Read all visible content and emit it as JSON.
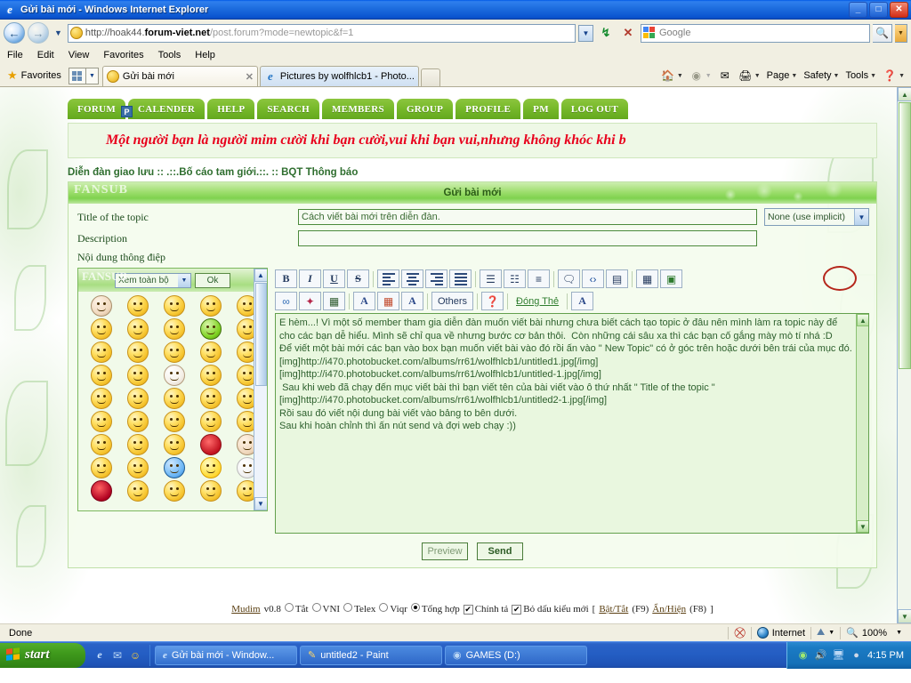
{
  "window": {
    "title": "Gửi bài mới - Windows Internet Explorer",
    "minimize": "_",
    "maximize": "□",
    "close": "✕"
  },
  "navigation": {
    "back": "←",
    "forward": "→",
    "history_caret": "▼",
    "url_prefix": "http://hoak44.",
    "url_domain": "forum-viet.net",
    "url_suffix": "/post.forum?mode=newtopic&f=1",
    "refresh": "↯",
    "stop": "✕",
    "address_dropdown": "▼"
  },
  "search": {
    "placeholder": "Google",
    "go_icon": "search-icon",
    "dropdown": "▼"
  },
  "menu": {
    "items": [
      "File",
      "Edit",
      "View",
      "Favorites",
      "Tools",
      "Help"
    ]
  },
  "tabstrip": {
    "favorites_label": "Favorites",
    "tabs": [
      {
        "label": "Gửi bài mới",
        "active": true,
        "close": "✕"
      },
      {
        "label": "Pictures by wolfhlcb1 - Photo...",
        "active": false,
        "close": ""
      }
    ]
  },
  "commandbar": {
    "items": [
      {
        "name": "home",
        "label": "",
        "caret": "▼"
      },
      {
        "name": "feeds",
        "label": "",
        "caret": "▼"
      },
      {
        "name": "mail",
        "label": "",
        "caret": ""
      },
      {
        "name": "print",
        "label": "",
        "caret": "▼"
      },
      {
        "name": "page",
        "label": "Page",
        "caret": "▼"
      },
      {
        "name": "safety",
        "label": "Safety",
        "caret": "▼"
      },
      {
        "name": "tools",
        "label": "Tools",
        "caret": "▼"
      },
      {
        "name": "help",
        "label": "",
        "caret": "▼"
      }
    ]
  },
  "forum": {
    "nav_tabs": [
      "FORUM",
      "CALENDER",
      "HELP",
      "SEARCH",
      "MEMBERS",
      "GROUP",
      "PROFILE",
      "PM",
      "LOG OUT"
    ],
    "p_badge": "P",
    "banner_text": "Một người bạn là người mim cười khi bạn cười,vui khi bạn vui,nhưng không khóc khi b",
    "breadcrumb": "Diễn đàn giao lưu  :: .::.Bố cáo tam giới.::. :: BQT Thông báo",
    "panel_title": "Gửi bài mới",
    "panel_watermark": "FANSUB",
    "fields": {
      "title_label": "Title of the topic",
      "title_value": "Cách viết bài mới trên diễn đàn.",
      "description_label": "Description",
      "description_value": "",
      "icon_select_value": "None (use implicit)",
      "message_label": "Nội dung thông điệp"
    },
    "smiley_panel": {
      "view_select": "Xem toàn bộ",
      "ok_button": "Ok",
      "scroll_up": "▲",
      "scroll_down": "▼"
    },
    "editor_toolbar": {
      "row1": [
        {
          "name": "bold-button",
          "glyph": "B",
          "style": "bold"
        },
        {
          "name": "italic-button",
          "glyph": "I",
          "style": "italic"
        },
        {
          "name": "underline-button",
          "glyph": "U",
          "style": "underline"
        },
        {
          "name": "strikethrough-button",
          "glyph": "S",
          "style": "strike"
        },
        {
          "name": "align-left-button",
          "glyph": "align-left-icon",
          "style": "align"
        },
        {
          "name": "align-center-button",
          "glyph": "align-center-icon",
          "style": "align"
        },
        {
          "name": "align-right-button",
          "glyph": "align-right-icon",
          "style": "align"
        },
        {
          "name": "align-justify-button",
          "glyph": "align-justify-icon",
          "style": "align"
        },
        {
          "name": "bullet-list-button",
          "glyph": "☰",
          "style": "icon"
        },
        {
          "name": "numbered-list-button",
          "glyph": "☷",
          "style": "icon"
        },
        {
          "name": "indent-button",
          "glyph": "≡",
          "style": "icon"
        },
        {
          "name": "quote-button",
          "glyph": "❝",
          "style": "icon"
        },
        {
          "name": "code-button",
          "glyph": "‹›",
          "style": "icon"
        },
        {
          "name": "table-button",
          "glyph": "▤",
          "style": "icon"
        },
        {
          "name": "insert-image-button",
          "glyph": "🖼",
          "style": "icon"
        },
        {
          "name": "upload-image-button",
          "glyph": "▣",
          "style": "icon"
        }
      ],
      "row2": [
        {
          "name": "link-button",
          "glyph": "∞",
          "style": "icon"
        },
        {
          "name": "flash-button",
          "glyph": "⚡",
          "style": "icon"
        },
        {
          "name": "video-button",
          "glyph": "▦",
          "style": "icon"
        },
        {
          "name": "font-color-button",
          "glyph": "A",
          "style": "icon"
        },
        {
          "name": "color-palette-button",
          "glyph": "⣿",
          "style": "icon"
        },
        {
          "name": "font-family-button",
          "glyph": "A",
          "style": "icon"
        },
        {
          "name": "others-button",
          "glyph": "Others",
          "style": "text"
        },
        {
          "name": "help-button",
          "glyph": "?",
          "style": "icon"
        },
        {
          "name": "close-tag-button",
          "glyph": "Đóng Thẻ",
          "style": "link"
        },
        {
          "name": "font-size-button",
          "glyph": "A",
          "style": "icon"
        }
      ]
    },
    "message_body": "E hèm...! Vì một số member tham gia diễn đàn muốn viết bài nhưng chưa biết cách tạo topic ở đâu nên mình làm ra topic này để cho các bạn dễ hiểu. Mình sẽ chỉ qua về nhưng bước cơ bản thôi.  Còn những cái sâu xa thì các bạn cố gắng mày mò tí nhá :D\nĐể viết một bài mới các bạn vào box bạn muốn viết bài vào đó rồi ấn vào \" New Topic\" có ở góc trên hoặc dưới bên trái của mục đó.\n[img]http://i470.photobucket.com/albums/rr61/wolfhlcb1/untitled1.jpg[/img]\n[img]http://i470.photobucket.com/albums/rr61/wolfhlcb1/untitled-1.jpg[/img]\n Sau khi web đã chạy đến mục viết bài thì bạn viết tên của bài viết vào ô thứ nhất \" Title of the topic \"\n[img]http://i470.photobucket.com/albums/rr61/wolfhlcb1/untitled2-1.jpg[/img]\nRồi sau đó viết nội dung bài viết vào bảng to bên dưới.\nSau khi hoàn chỉnh thì ấn nút send và đợi web chạy :))",
    "buttons": {
      "preview": "Preview",
      "send": "Send"
    }
  },
  "mudim": {
    "brand": "Mudim",
    "version": "v0.8",
    "modes": [
      {
        "label": "Tắt",
        "selected": false
      },
      {
        "label": "VNI",
        "selected": false
      },
      {
        "label": "Telex",
        "selected": false
      },
      {
        "label": "Viqr",
        "selected": false
      },
      {
        "label": "Tổng hợp",
        "selected": true
      }
    ],
    "checks": [
      {
        "label": "Chính tả",
        "checked": true
      },
      {
        "label": "Bỏ dấu kiểu mới",
        "checked": true
      }
    ],
    "bracket_open": "[",
    "toggle_link": "Bật/Tắt",
    "toggle_key": "(F9)",
    "hide_link": "Ẩn/Hiện",
    "hide_key": "(F8)",
    "bracket_close": "]",
    "check_mark": "✔"
  },
  "statusbar": {
    "status": "Done",
    "zone": "Internet",
    "zoom": "100%",
    "zoom_caret": "▼",
    "protect_caret": "▼"
  },
  "taskbar": {
    "start_label": "start",
    "quicklaunch": [
      "ie-icon",
      "outlook-icon",
      "smiley-icon"
    ],
    "tasks": [
      {
        "label": "Gửi bài mới - Window...",
        "icon": "ie-icon",
        "active": true
      },
      {
        "label": "untitled2 - Paint",
        "icon": "paint-icon",
        "active": false
      },
      {
        "label": "GAMES (D:)",
        "icon": "drive-icon",
        "active": false
      }
    ],
    "tray_icons": [
      "network-icon",
      "volume-icon",
      "connection-icon",
      "shield-icon"
    ],
    "clock": "4:15 PM"
  },
  "colors": {
    "accent_green": "#76b82a",
    "banner_red": "#e8001c",
    "title_blue": "#1f6fe0",
    "taskbar_blue": "#245ec4",
    "start_green": "#3f9a1c"
  }
}
